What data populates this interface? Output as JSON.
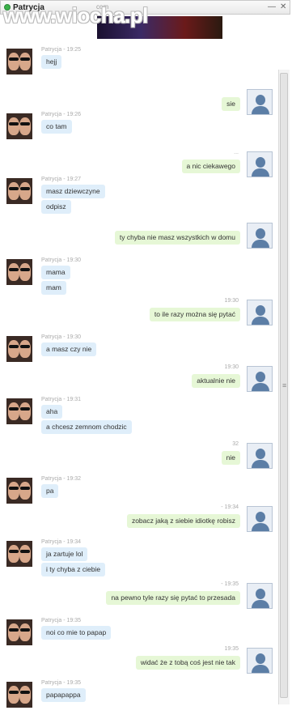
{
  "window": {
    "contact_name": "Patrycja",
    "subtitle": "com",
    "minimize": "—",
    "close": "✕",
    "watermark": "www.wiocha.pl"
  },
  "messages": [
    {
      "side": "left",
      "meta": "Patrycja - 19:25",
      "lines": [
        "hejj"
      ]
    },
    {
      "side": "right",
      "meta": "",
      "lines": [
        "sie"
      ]
    },
    {
      "side": "left",
      "meta": "Patrycja - 19:26",
      "lines": [
        "co tam"
      ]
    },
    {
      "side": "right",
      "meta": "...",
      "lines": [
        "a nic ciekawego"
      ]
    },
    {
      "side": "left",
      "meta": "Patrycja - 19:27",
      "lines": [
        "masz dziewczyne",
        "odpisz"
      ]
    },
    {
      "side": "right",
      "meta": "",
      "lines": [
        "ty chyba nie masz wszystkich w domu"
      ]
    },
    {
      "side": "left",
      "meta": "Patrycja - 19:30",
      "lines": [
        "mama",
        "mam"
      ]
    },
    {
      "side": "right",
      "meta": "19:30",
      "lines": [
        "to ile razy można się pytać"
      ]
    },
    {
      "side": "left",
      "meta": "Patrycja - 19:30",
      "lines": [
        "a masz czy nie"
      ]
    },
    {
      "side": "right",
      "meta": "19:30",
      "lines": [
        "aktualnie nie"
      ]
    },
    {
      "side": "left",
      "meta": "Patrycja - 19:31",
      "lines": [
        "aha",
        "a chcesz zemnom chodzic"
      ]
    },
    {
      "side": "right",
      "meta": "32",
      "lines": [
        "nie"
      ]
    },
    {
      "side": "left",
      "meta": "Patrycja - 19:32",
      "lines": [
        "pa"
      ]
    },
    {
      "side": "right",
      "meta": "- 19:34",
      "lines": [
        "zobacz jaką z siebie idiotkę robisz"
      ]
    },
    {
      "side": "left",
      "meta": "Patrycja - 19:34",
      "lines": [
        "ja zartuje lol",
        "i ty chyba z ciebie"
      ]
    },
    {
      "side": "right",
      "meta": "- 19:35",
      "lines": [
        "na pewno tyle razy się pytać to przesada"
      ]
    },
    {
      "side": "left",
      "meta": "Patrycja - 19:35",
      "lines": [
        "noi co mie to papap"
      ]
    },
    {
      "side": "right",
      "meta": "19:35",
      "lines": [
        "widać że z tobą coś jest nie tak"
      ]
    },
    {
      "side": "left",
      "meta": "Patrycja - 19:35",
      "lines": [
        "papapappa"
      ]
    }
  ]
}
